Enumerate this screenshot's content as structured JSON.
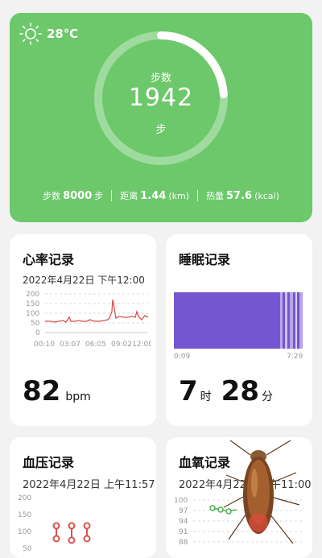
{
  "weather": {
    "icon": "sun-icon",
    "temperature": "28℃"
  },
  "steps": {
    "label": "步数",
    "value": "1942",
    "unit": "步",
    "progress": 0.24,
    "goal_label": "步数",
    "goal_value": "8000",
    "goal_unit": "步",
    "distance_label": "距离",
    "distance_value": "1.44",
    "distance_unit": "(km)",
    "calorie_label": "热量",
    "calorie_value": "57.6",
    "calorie_unit": "(kcal)"
  },
  "heart": {
    "title": "心率记录",
    "date": "2022年4月22日 下午12:00",
    "y_ticks": [
      "200",
      "150",
      "100",
      "50",
      "0"
    ],
    "x_ticks": [
      "00:10",
      "03:07",
      "06:05",
      "09:02",
      "12:00"
    ],
    "value": "82",
    "unit": "bpm"
  },
  "sleep": {
    "title": "睡眠记录",
    "start": "0:09",
    "end": "7:29",
    "hours": "7",
    "hours_unit": "时",
    "minutes": "28",
    "minutes_unit": "分"
  },
  "bp": {
    "title": "血压记录",
    "date": "2022年4月22日 上午11:57",
    "y_ticks": [
      "200",
      "150",
      "100",
      "50"
    ]
  },
  "oxygen": {
    "title": "血氧记录",
    "date": "2022年4月22日 上午11:00",
    "y_ticks": [
      "100",
      "97",
      "94",
      "91",
      "88"
    ]
  },
  "colors": {
    "green": "#6cc86a",
    "heart_line": "#d9534f",
    "sleep": "#7655d0",
    "bp": "#d9534f",
    "oxygen": "#4caf50"
  }
}
